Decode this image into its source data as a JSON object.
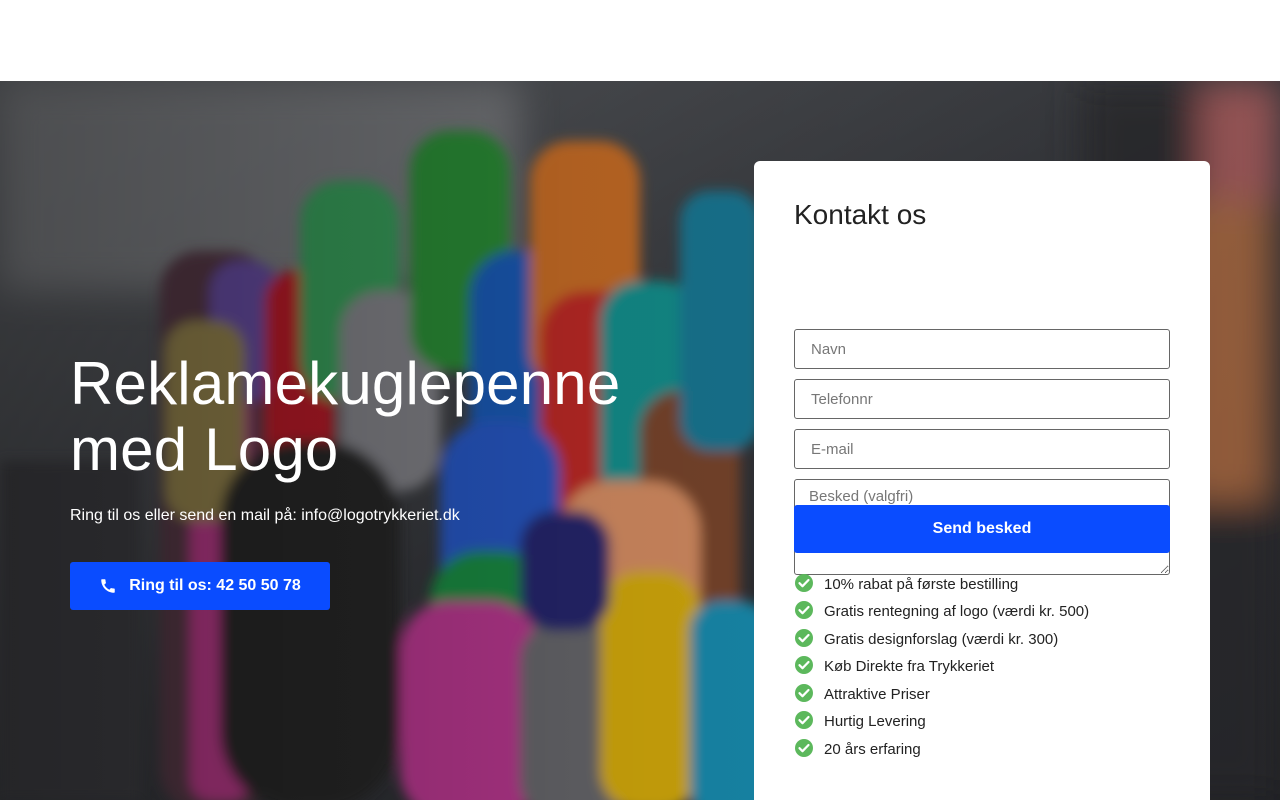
{
  "hero": {
    "title_line1": "Reklamekuglepenne",
    "title_line2": "med Logo",
    "subtitle": "Ring til os eller send en mail på: info@logotrykkeriet.dk",
    "call_button": "Ring til os: 42 50 50 78"
  },
  "contact": {
    "title": "Kontakt os",
    "name_placeholder": "Navn",
    "phone_placeholder": "Telefonnr",
    "email_placeholder": "E-mail",
    "message_placeholder": "Besked (valgfri)",
    "send_button": "Send besked",
    "benefits": [
      "10% rabat på første bestilling",
      "Gratis rentegning af logo (værdi kr. 500)",
      "Gratis designforslag (værdi kr. 300)",
      "Køb Direkte fra Trykkeriet",
      "Attraktive Priser",
      "Hurtig Levering",
      "20 års erfaring"
    ]
  },
  "colors": {
    "accent": "#0a4cff",
    "check": "#5cb85c"
  },
  "icons": {
    "call": "phone-icon",
    "benefit": "check-circle-icon"
  }
}
